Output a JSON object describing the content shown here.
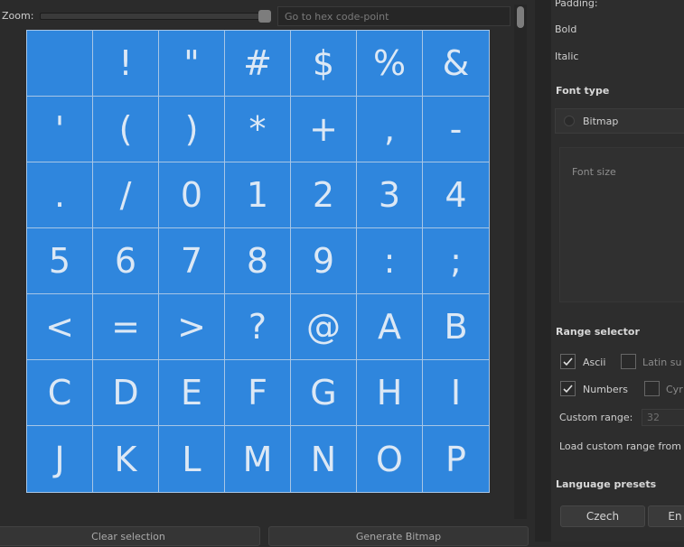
{
  "toolbar": {
    "zoom_label": "Zoom:",
    "hex_placeholder": "Go to hex code-point"
  },
  "glyphs": [
    " ",
    "!",
    "\"",
    "#",
    "$",
    "%",
    "&",
    "'",
    "(",
    ")",
    "*",
    "+",
    ",",
    "-",
    ".",
    "/",
    "0",
    "1",
    "2",
    "3",
    "4",
    "5",
    "6",
    "7",
    "8",
    "9",
    ":",
    ";",
    "<",
    "=",
    ">",
    "?",
    "@",
    "A",
    "B",
    "C",
    "D",
    "E",
    "F",
    "G",
    "H",
    "I",
    "J",
    "K",
    "L",
    "M",
    "N",
    "O",
    "P"
  ],
  "bottom": {
    "clear_label": "Clear selection",
    "generate_label": "Generate Bitmap"
  },
  "panel": {
    "padding_label": "Padding:",
    "bold_label": "Bold",
    "italic_label": "Italic",
    "font_type_title": "Font type",
    "bitmap_label": "Bitmap",
    "font_size_label": "Font size",
    "range_selector_title": "Range selector",
    "ascii_label": "Ascii",
    "latin_label": "Latin su",
    "numbers_label": "Numbers",
    "cyrillic_label": "Cyr",
    "custom_range_label": "Custom range:",
    "custom_range_value": "32",
    "load_custom_label": "Load custom range from",
    "language_presets_title": "Language presets",
    "czech_label": "Czech",
    "en_label": "En"
  },
  "colors": {
    "grid_background": "#2f86dd",
    "grid_lines": "#a7c6e6",
    "app_background": "#2b2b2b"
  }
}
